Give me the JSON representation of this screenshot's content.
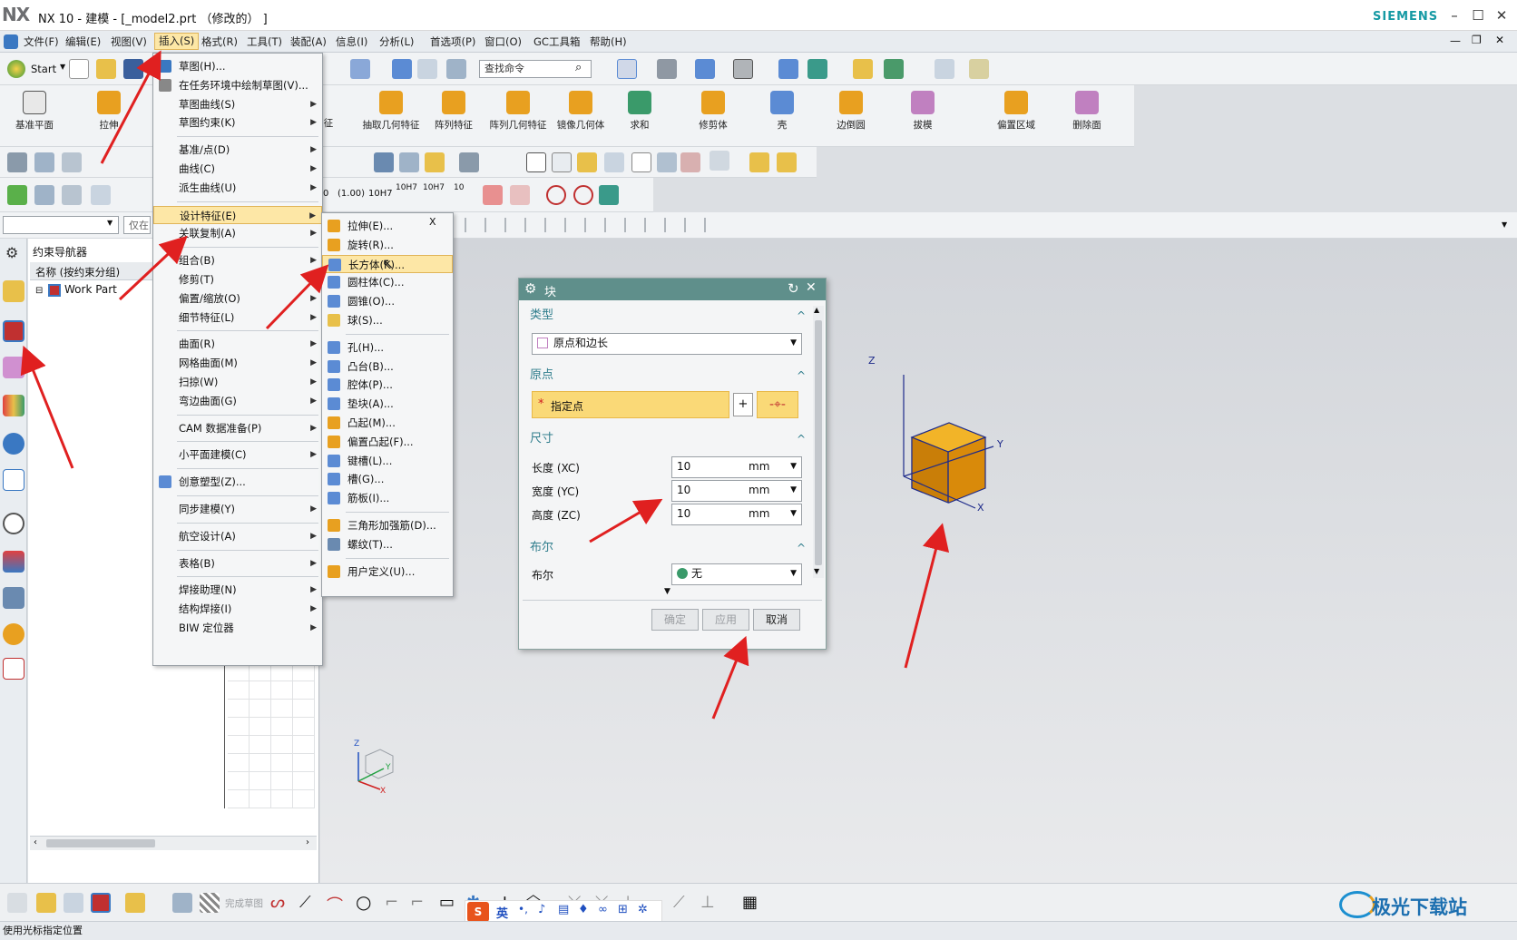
{
  "window": {
    "logo": "NX",
    "title": "NX 10 - 建模 - [_model2.prt （修改的） ]",
    "brand": "SIEMENS",
    "min": "–",
    "max": "☐",
    "close": "✕"
  },
  "menubar": [
    "文件(F)",
    "编辑(E)",
    "视图(V)",
    "插入(S)",
    "格式(R)",
    "工具(T)",
    "装配(A)",
    "信息(I)",
    "分析(L)",
    "首选项(P)",
    "窗口(O)",
    "GC工具箱",
    "帮助(H)"
  ],
  "toolbar": {
    "start": "Start",
    "search_placeholder": "查找命令",
    "big_buttons": [
      "基准平面",
      "拉伸",
      "征",
      "抽取几何特征",
      "阵列特征",
      "阵列几何特征",
      "镜像几何体",
      "求和",
      "修剪体",
      "壳",
      "边倒圆",
      "拔模",
      "偏置区域",
      "删除面"
    ],
    "tolerance_labels": [
      "0",
      "(1.00)",
      "10H7",
      "10H7",
      "10H7",
      "10"
    ]
  },
  "filter": {
    "value": "",
    "scope": "仅在"
  },
  "navigator": {
    "title": "约束导航器",
    "column": "名称 (按约束分组)",
    "root": "Work Part"
  },
  "insert_menu": [
    {
      "label": "草图(H)...",
      "arrow": false
    },
    {
      "label": "在任务环境中绘制草图(V)...",
      "arrow": false
    },
    {
      "label": "草图曲线(S)",
      "arrow": true
    },
    {
      "label": "草图约束(K)",
      "arrow": true
    },
    {
      "label": "基准/点(D)",
      "arrow": true
    },
    {
      "label": "曲线(C)",
      "arrow": true
    },
    {
      "label": "派生曲线(U)",
      "arrow": true
    },
    {
      "label": "设计特征(E)",
      "arrow": true
    },
    {
      "label": "关联复制(A)",
      "arrow": true
    },
    {
      "label": "组合(B)",
      "arrow": true
    },
    {
      "label": "修剪(T)",
      "arrow": true
    },
    {
      "label": "偏置/缩放(O)",
      "arrow": true
    },
    {
      "label": "细节特征(L)",
      "arrow": true
    },
    {
      "label": "曲面(R)",
      "arrow": true
    },
    {
      "label": "网格曲面(M)",
      "arrow": true
    },
    {
      "label": "扫掠(W)",
      "arrow": true
    },
    {
      "label": "弯边曲面(G)",
      "arrow": true
    },
    {
      "label": "CAM 数据准备(P)",
      "arrow": true
    },
    {
      "label": "小平面建模(C)",
      "arrow": true
    },
    {
      "label": "创意塑型(Z)...",
      "arrow": false
    },
    {
      "label": "同步建模(Y)",
      "arrow": true
    },
    {
      "label": "航空设计(A)",
      "arrow": true
    },
    {
      "label": "表格(B)",
      "arrow": true
    },
    {
      "label": "焊接助理(N)",
      "arrow": true
    },
    {
      "label": "结构焊接(I)",
      "arrow": true
    },
    {
      "label": "BIW 定位器",
      "arrow": true
    }
  ],
  "design_feature_menu": {
    "close": "X",
    "items": [
      "拉伸(E)...",
      "旋转(R)...",
      "长方体(K)...",
      "圆柱体(C)...",
      "圆锥(O)...",
      "球(S)...",
      "孔(H)...",
      "凸台(B)...",
      "腔体(P)...",
      "垫块(A)...",
      "凸起(M)...",
      "偏置凸起(F)...",
      "键槽(L)...",
      "槽(G)...",
      "筋板(I)...",
      "三角形加强筋(D)...",
      "螺纹(T)...",
      "用户定义(U)..."
    ]
  },
  "dialog": {
    "title": "块",
    "type_section": "类型",
    "type_value": "原点和边长",
    "origin_section": "原点",
    "origin_required": "*",
    "origin_label": "指定点",
    "size_section": "尺寸",
    "rows": [
      {
        "label": "长度 (XC)",
        "value": "10",
        "unit": "mm"
      },
      {
        "label": "宽度 (YC)",
        "value": "10",
        "unit": "mm"
      },
      {
        "label": "高度 (ZC)",
        "value": "10",
        "unit": "mm"
      }
    ],
    "bool_section": "布尔",
    "bool_label": "布尔",
    "bool_value": "无",
    "ok": "确定",
    "apply": "应用",
    "cancel": "取消"
  },
  "viewport": {
    "axes": {
      "x": "X",
      "y": "Y",
      "z": "Z"
    },
    "cube_color": "#e4940c",
    "triad": {
      "x": "X",
      "y": "Y",
      "z": "Z"
    }
  },
  "bottom_toolbar": {
    "finish_sketch": "完成草图"
  },
  "ime": {
    "lang": "英"
  },
  "watermark": "极光下载站",
  "status": "使用光标指定位置",
  "arrow_color": "#e02020"
}
